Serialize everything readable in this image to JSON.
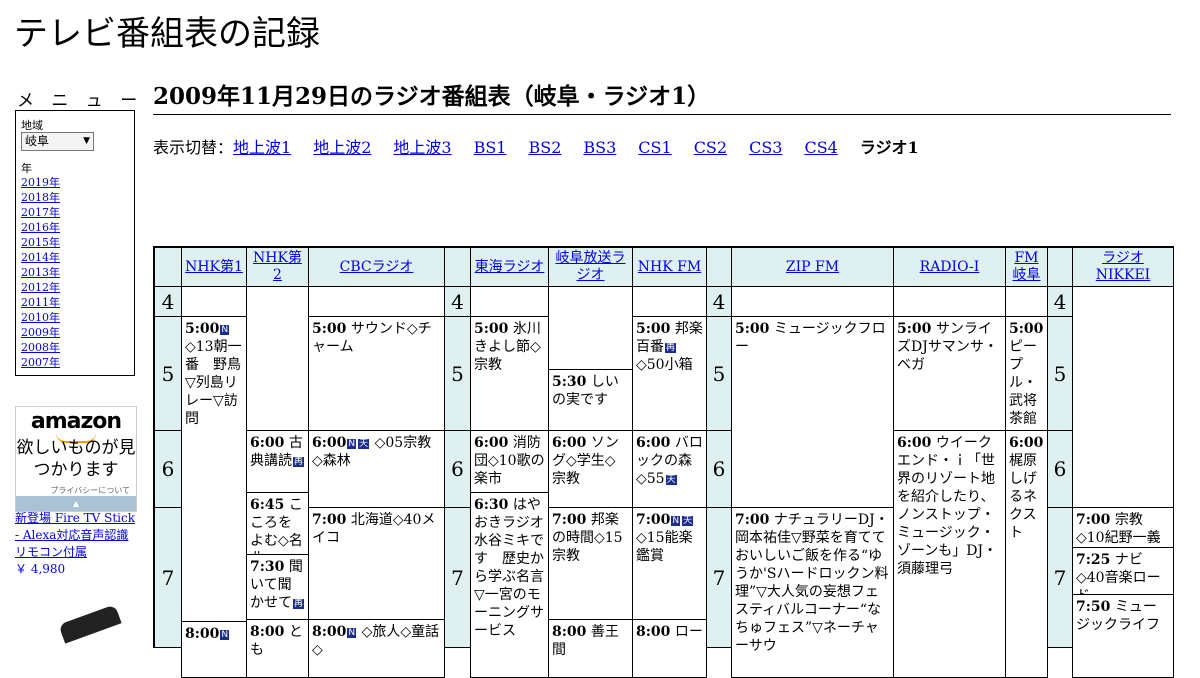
{
  "site_title": "テレビ番組表の記録",
  "menu": {
    "heading": "メ ニ ュ ー",
    "region_label": "地域",
    "region_value": "岐阜",
    "year_label": "年",
    "years": [
      "2019年",
      "2018年",
      "2017年",
      "2016年",
      "2015年",
      "2014年",
      "2013年",
      "2012年",
      "2011年",
      "2010年",
      "2009年",
      "2008年",
      "2007年"
    ]
  },
  "ad": {
    "logo": "amazon",
    "tagline": "欲しいものが見つかります",
    "privacy": "プライバシーについて",
    "product": "新登場 Fire TV Stick - Alexa対応音声認識リモコン付属",
    "price": "￥ 4,980"
  },
  "heading": "2009年11月29日のラジオ番組表（岐阜・ラジオ1）",
  "switcher": {
    "label": "表示切替：",
    "links": [
      "地上波1",
      "地上波2",
      "地上波3",
      "BS1",
      "BS2",
      "BS3",
      "CS1",
      "CS2",
      "CS3",
      "CS4"
    ],
    "current": "ラジオ1"
  },
  "badges": {
    "news": "N",
    "weather": "天",
    "repeat": "再"
  },
  "channels": [
    "NHK第1",
    "NHK第2",
    "CBCラジオ",
    "東海ラジオ",
    "岐阜放送ラジオ",
    "NHK FM",
    "ZIP FM",
    "RADIO-I",
    "FM岐阜",
    "ラジオNIKKEI"
  ],
  "hours": [
    "4",
    "5",
    "6",
    "7"
  ],
  "programs": {
    "nhk1_500": {
      "time": "5:00",
      "title": "◇13朝一番　野鳥▽列島リレー▽訪問"
    },
    "nhk1_800": {
      "time": "8:00"
    },
    "nhk2_600": {
      "time": "6:00",
      "title": "古典講読"
    },
    "nhk2_645": {
      "time": "6:45",
      "title": "こころをよむ◇名曲"
    },
    "nhk2_730": {
      "time": "7:30",
      "title": "聞いて聞かせて"
    },
    "nhk2_800": {
      "time": "8:00",
      "title": "とも"
    },
    "cbc_500": {
      "time": "5:00",
      "title": "サウンド◇チャーム"
    },
    "cbc_600": {
      "time": "6:00",
      "title": "◇05宗教◇森林"
    },
    "cbc_700": {
      "time": "7:00",
      "title": "北海道◇40メイコ"
    },
    "cbc_800": {
      "time": "8:00",
      "title": "◇旅人◇童話◇"
    },
    "tokai_500": {
      "time": "5:00",
      "title": "氷川きよし節◇宗教"
    },
    "tokai_600": {
      "time": "6:00",
      "title": "消防団◇10歌の楽市"
    },
    "tokai_630": {
      "time": "6:30",
      "title": "はやおきラジオ水谷ミキです　歴史から学ぶ名言▽一宮のモーニングサービス"
    },
    "gifu_530": {
      "time": "5:30",
      "title": "しいの実です"
    },
    "gifu_600": {
      "time": "6:00",
      "title": "ソング◇学生◇宗教"
    },
    "gifu_700": {
      "time": "7:00",
      "title": "邦楽の時間◇15宗教"
    },
    "gifu_800": {
      "time": "8:00",
      "title": "善王間"
    },
    "nhkfm_500": {
      "time": "5:00",
      "title_a": "邦楽百番",
      "title_b": "◇50小箱"
    },
    "nhkfm_600": {
      "time": "6:00",
      "title": "バロックの森◇55"
    },
    "nhkfm_700": {
      "time": "7:00",
      "title": "◇15能楽鑑賞"
    },
    "nhkfm_800": {
      "time": "8:00",
      "title": "ロー"
    },
    "zip_500": {
      "time": "5:00",
      "title": "ミュージックフロー"
    },
    "zip_700": {
      "time": "7:00",
      "title": "ナチュラリーDJ・岡本祐佳▽野菜を育てておいしいご飯を作る“ゆうか'Sハードロックン料理”▽大人気の妄想フェスティバルコーナー“なちゅフェス”▽ネーチャーサウ"
    },
    "radioi_500": {
      "time": "5:00",
      "title": "サンライズDJサマンサ・ベガ"
    },
    "radioi_600": {
      "time": "6:00",
      "title": "ウイークエンド・ｉ「世界のリゾート地を紹介したり、ノンストップ・ミュージック・ゾーンも」DJ・須藤理弓"
    },
    "fmgifu_500": {
      "time": "5:00",
      "title": "ピープル・武将茶館"
    },
    "fmgifu_600": {
      "time": "6:00",
      "title": "梶原しげるネクスト"
    },
    "nikkei_700": {
      "time": "7:00",
      "title": "宗教◇10紀野一義"
    },
    "nikkei_725": {
      "time": "7:25",
      "title": "ナビ◇40音楽ロード"
    },
    "nikkei_750": {
      "time": "7:50",
      "title": "ミュージックライフ"
    }
  }
}
